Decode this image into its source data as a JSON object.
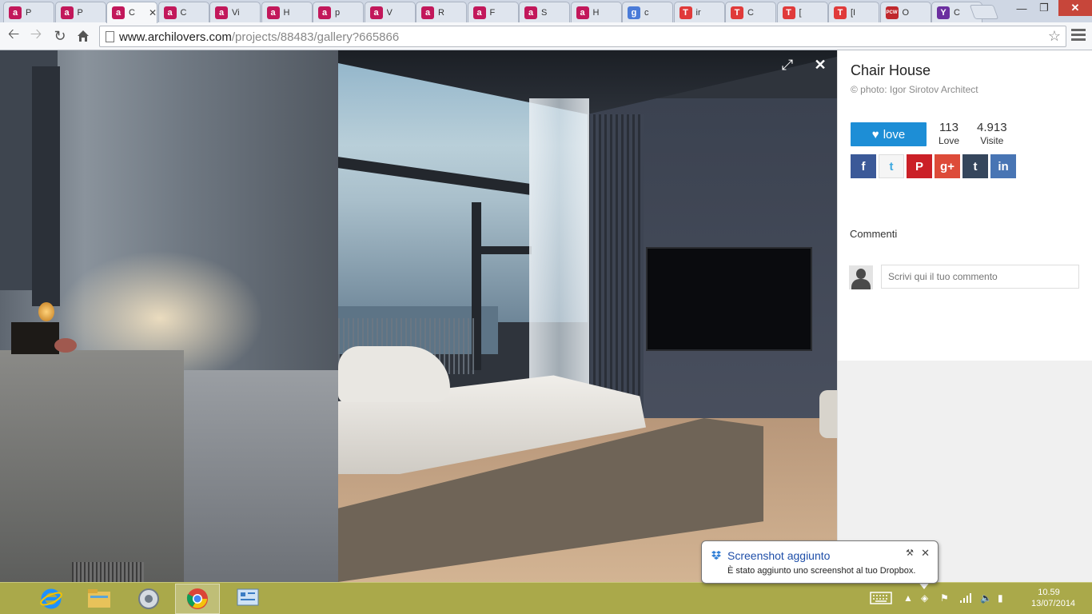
{
  "browser": {
    "tabs": [
      {
        "icon": "a",
        "color": "#c2185b",
        "title": "P"
      },
      {
        "icon": "a",
        "color": "#c2185b",
        "title": "P"
      },
      {
        "icon": "a",
        "color": "#c2185b",
        "title": "C",
        "active": true
      },
      {
        "icon": "a",
        "color": "#c2185b",
        "title": "C"
      },
      {
        "icon": "a",
        "color": "#c2185b",
        "title": "Vi"
      },
      {
        "icon": "a",
        "color": "#c2185b",
        "title": "H"
      },
      {
        "icon": "a",
        "color": "#c2185b",
        "title": "p"
      },
      {
        "icon": "a",
        "color": "#c2185b",
        "title": "V"
      },
      {
        "icon": "a",
        "color": "#c2185b",
        "title": "R"
      },
      {
        "icon": "a",
        "color": "#c2185b",
        "title": "F"
      },
      {
        "icon": "a",
        "color": "#c2185b",
        "title": "S"
      },
      {
        "icon": "a",
        "color": "#c2185b",
        "title": "H"
      },
      {
        "icon": "g",
        "color": "#4a7bd8",
        "title": "c"
      },
      {
        "icon": "T",
        "color": "#e03a3a",
        "title": "ir"
      },
      {
        "icon": "T",
        "color": "#e03a3a",
        "title": "C"
      },
      {
        "icon": "T",
        "color": "#e03a3a",
        "title": "["
      },
      {
        "icon": "T",
        "color": "#e03a3a",
        "title": "[I"
      },
      {
        "icon": "PCW",
        "color": "#c0282d",
        "title": "O"
      },
      {
        "icon": "Y",
        "color": "#6b2fa0",
        "title": "C"
      }
    ],
    "url_host": "www.archilovers.com",
    "url_path": "/projects/88483/gallery?665866"
  },
  "sidebar": {
    "project_title": "Chair House",
    "photo_credit": "© photo: Igor Sirotov Architect",
    "love_label": "love",
    "stats": {
      "love_count": "113",
      "love_label": "Love",
      "visits_count": "4.913",
      "visits_label": "Visite"
    },
    "share": [
      {
        "name": "facebook",
        "glyph": "f",
        "color": "#3b5998",
        "fg": "#fff"
      },
      {
        "name": "twitter",
        "glyph": "t",
        "color": "#f5f5f5",
        "fg": "#3fa9e0"
      },
      {
        "name": "pinterest",
        "glyph": "P",
        "color": "#cb2027",
        "fg": "#fff"
      },
      {
        "name": "googleplus",
        "glyph": "g+",
        "color": "#dd4b39",
        "fg": "#fff"
      },
      {
        "name": "tumblr",
        "glyph": "t",
        "color": "#35465c",
        "fg": "#fff"
      },
      {
        "name": "linkedin",
        "glyph": "in",
        "color": "#4875b4",
        "fg": "#fff"
      }
    ],
    "comments_label": "Commenti",
    "comment_placeholder": "Scrivi qui il tuo commento"
  },
  "notification": {
    "title": "Screenshot aggiunto",
    "body": "È stato aggiunto uno screenshot al tuo Dropbox."
  },
  "taskbar": {
    "time": "10.59",
    "date": "13/07/2014"
  }
}
